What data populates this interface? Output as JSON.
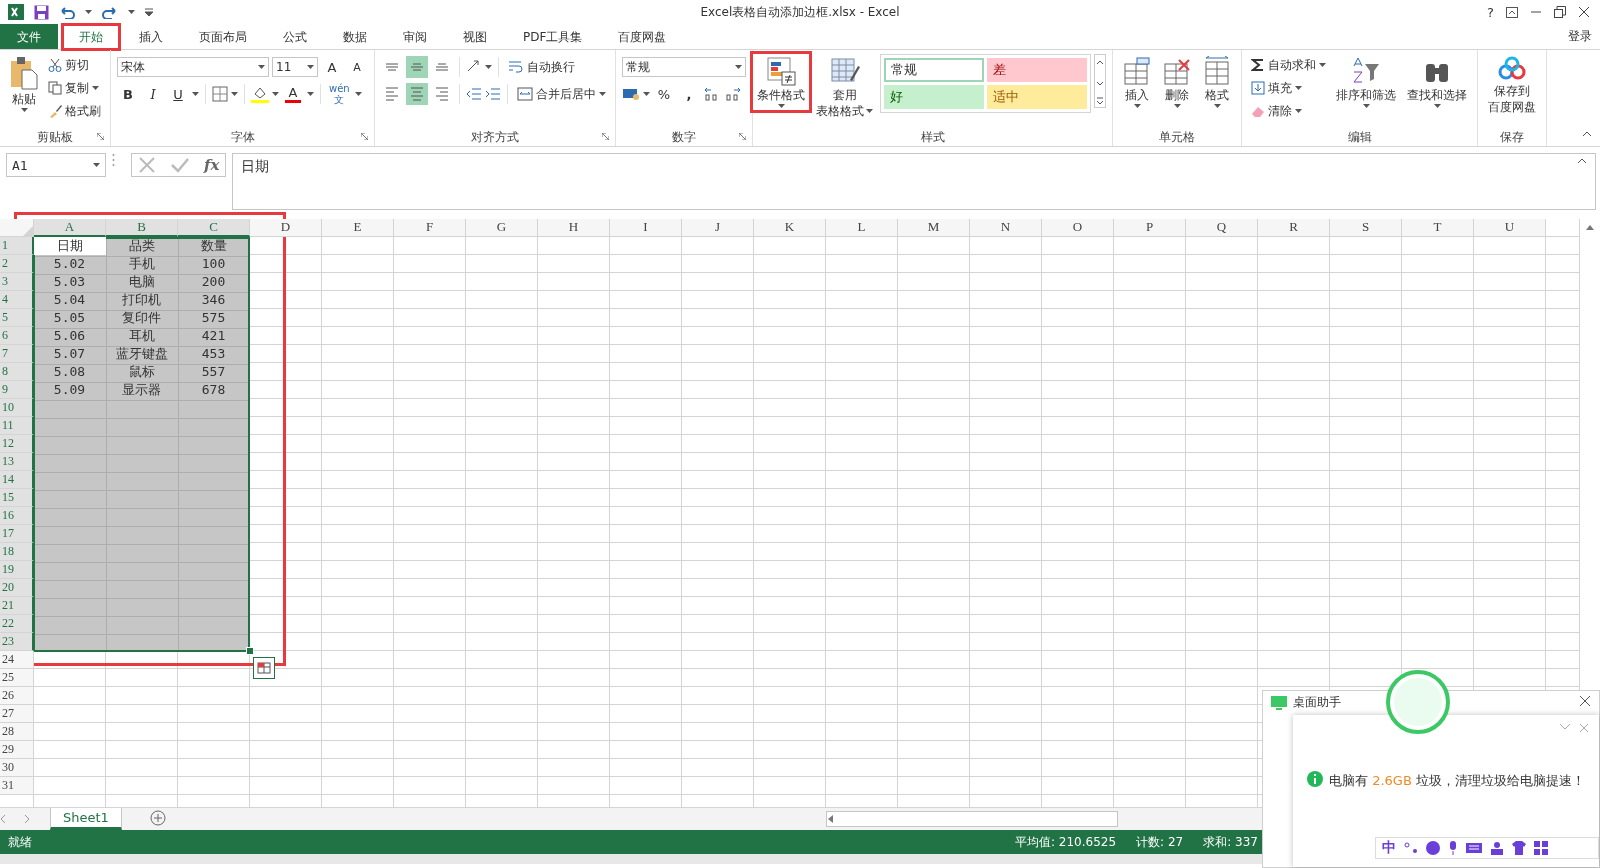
{
  "title_bar": {
    "title": "Excel表格自动添加边框.xlsx - Excel",
    "help": "?"
  },
  "tabs": [
    {
      "label": "文件",
      "kind": "file",
      "selected": false,
      "highlighted": false
    },
    {
      "label": "开始",
      "kind": "tab",
      "selected": true,
      "highlighted": true
    },
    {
      "label": "插入",
      "kind": "tab",
      "selected": false,
      "highlighted": false
    },
    {
      "label": "页面布局",
      "kind": "tab",
      "selected": false,
      "highlighted": false
    },
    {
      "label": "公式",
      "kind": "tab",
      "selected": false,
      "highlighted": false
    },
    {
      "label": "数据",
      "kind": "tab",
      "selected": false,
      "highlighted": false
    },
    {
      "label": "审阅",
      "kind": "tab",
      "selected": false,
      "highlighted": false
    },
    {
      "label": "视图",
      "kind": "tab",
      "selected": false,
      "highlighted": false
    },
    {
      "label": "PDF工具集",
      "kind": "tab",
      "selected": false,
      "highlighted": false
    },
    {
      "label": "百度网盘",
      "kind": "tab",
      "selected": false,
      "highlighted": false
    }
  ],
  "sign_in": "登录",
  "ribbon": {
    "clipboard": {
      "label": "剪贴板",
      "launcher": true,
      "paste": "粘贴",
      "cut": "剪切",
      "copy": "复制",
      "painter": "格式刷"
    },
    "font": {
      "label": "字体",
      "launcher": true,
      "name": "宋体",
      "size": "11",
      "grow": "A",
      "shrink": "A",
      "bold": "B",
      "italic": "I",
      "underline": "U",
      "color_letter": "A",
      "phonetic": "wén",
      "phonetic_char": "文"
    },
    "alignment": {
      "label": "对齐方式",
      "launcher": true,
      "vertical": [
        {
          "kind": "top",
          "selected": false
        },
        {
          "kind": "middle",
          "selected": true
        },
        {
          "kind": "bottom",
          "selected": false
        }
      ],
      "horizontal": [
        {
          "kind": "left",
          "selected": false
        },
        {
          "kind": "center",
          "selected": true
        },
        {
          "kind": "right",
          "selected": false
        }
      ],
      "wrap": "自动换行",
      "merge": "合并后居中"
    },
    "number": {
      "label": "数字",
      "launcher": true,
      "format": "常规",
      "percent": "%",
      "comma": ","
    },
    "styles": {
      "label": "样式",
      "conditional": {
        "label": "条件格式",
        "highlighted": true
      },
      "table_format": [
        "套用",
        "表格格式"
      ],
      "gallery": [
        {
          "label": "常规",
          "kind": "normal",
          "selected": true
        },
        {
          "label": "差",
          "kind": "bad",
          "selected": false
        },
        {
          "label": "好",
          "kind": "good",
          "selected": false
        },
        {
          "label": "适中",
          "kind": "neutral",
          "selected": false
        }
      ]
    },
    "cells": {
      "label": "单元格",
      "insert": "插入",
      "delete": "删除",
      "format": "格式"
    },
    "editing": {
      "label": "编辑",
      "autosum": "自动求和",
      "fill": "填充",
      "clear": "清除",
      "sort": "排序和筛选",
      "find": "查找和选择"
    },
    "save": {
      "label": "保存",
      "button": [
        "保存到",
        "百度网盘"
      ]
    }
  },
  "formula_bar": {
    "name_box": "A1",
    "fx": "fx",
    "content": "日期"
  },
  "sheet": {
    "annotation_frame": true,
    "columns": [
      {
        "label": "A",
        "selected": true
      },
      {
        "label": "B",
        "selected": true
      },
      {
        "label": "C",
        "selected": true
      },
      {
        "label": "D",
        "selected": false
      },
      {
        "label": "E",
        "selected": false
      },
      {
        "label": "F",
        "selected": false
      },
      {
        "label": "G",
        "selected": false
      },
      {
        "label": "H",
        "selected": false
      },
      {
        "label": "I",
        "selected": false
      },
      {
        "label": "J",
        "selected": false
      },
      {
        "label": "K",
        "selected": false
      },
      {
        "label": "L",
        "selected": false
      },
      {
        "label": "M",
        "selected": false
      },
      {
        "label": "N",
        "selected": false
      },
      {
        "label": "O",
        "selected": false
      },
      {
        "label": "P",
        "selected": false
      },
      {
        "label": "Q",
        "selected": false
      },
      {
        "label": "R",
        "selected": false
      },
      {
        "label": "S",
        "selected": false
      },
      {
        "label": "T",
        "selected": false
      },
      {
        "label": "U",
        "selected": false
      }
    ],
    "rows": [
      {
        "label": "1",
        "selected": true,
        "active": true,
        "cells": [
          "日期",
          "品类",
          "数量"
        ]
      },
      {
        "label": "2",
        "selected": true,
        "active": false,
        "cells": [
          "5.02",
          "手机",
          "100"
        ]
      },
      {
        "label": "3",
        "selected": true,
        "active": false,
        "cells": [
          "5.03",
          "电脑",
          "200"
        ]
      },
      {
        "label": "4",
        "selected": true,
        "active": false,
        "cells": [
          "5.04",
          "打印机",
          "346"
        ]
      },
      {
        "label": "5",
        "selected": true,
        "active": false,
        "cells": [
          "5.05",
          "复印件",
          "575"
        ]
      },
      {
        "label": "6",
        "selected": true,
        "active": false,
        "cells": [
          "5.06",
          "耳机",
          "421"
        ]
      },
      {
        "label": "7",
        "selected": true,
        "active": false,
        "cells": [
          "5.07",
          "蓝牙键盘",
          "453"
        ]
      },
      {
        "label": "8",
        "selected": true,
        "active": false,
        "cells": [
          "5.08",
          "鼠标",
          "557"
        ]
      },
      {
        "label": "9",
        "selected": true,
        "active": false,
        "cells": [
          "5.09",
          "显示器",
          "678"
        ]
      },
      {
        "label": "10",
        "selected": true,
        "active": false
      },
      {
        "label": "11",
        "selected": true,
        "active": false
      },
      {
        "label": "12",
        "selected": true,
        "active": false
      },
      {
        "label": "13",
        "selected": true,
        "active": false
      },
      {
        "label": "14",
        "selected": true,
        "active": false
      },
      {
        "label": "15",
        "selected": true,
        "active": false
      },
      {
        "label": "16",
        "selected": true,
        "active": false
      },
      {
        "label": "17",
        "selected": true,
        "active": false
      },
      {
        "label": "18",
        "selected": true,
        "active": false
      },
      {
        "label": "19",
        "selected": true,
        "active": false
      },
      {
        "label": "20",
        "selected": true,
        "active": false
      },
      {
        "label": "21",
        "selected": true,
        "active": false
      },
      {
        "label": "22",
        "selected": true,
        "active": false
      },
      {
        "label": "23",
        "selected": true,
        "active": false
      },
      {
        "label": "24",
        "selected": false,
        "active": false
      },
      {
        "label": "25",
        "selected": false,
        "active": false
      },
      {
        "label": "26",
        "selected": false,
        "active": false
      },
      {
        "label": "27",
        "selected": false,
        "active": false
      },
      {
        "label": "28",
        "selected": false,
        "active": false
      },
      {
        "label": "29",
        "selected": false,
        "active": false
      },
      {
        "label": "30",
        "selected": false,
        "active": false
      },
      {
        "label": "31",
        "selected": false,
        "active": false
      }
    ]
  },
  "sheet_tabs": [
    {
      "label": "Sheet1",
      "selected": true
    }
  ],
  "status_bar": {
    "ready": "就绪",
    "average": "平均值: 210.6525",
    "count": "计数: 27",
    "sum": "求和: 337"
  },
  "popup": {
    "title": "桌面助手",
    "message": {
      "before": "电脑有 ",
      "highlight": "2.6GB",
      "after": " 垃圾，清理垃圾给电脑提速！"
    },
    "ime": "中"
  }
}
